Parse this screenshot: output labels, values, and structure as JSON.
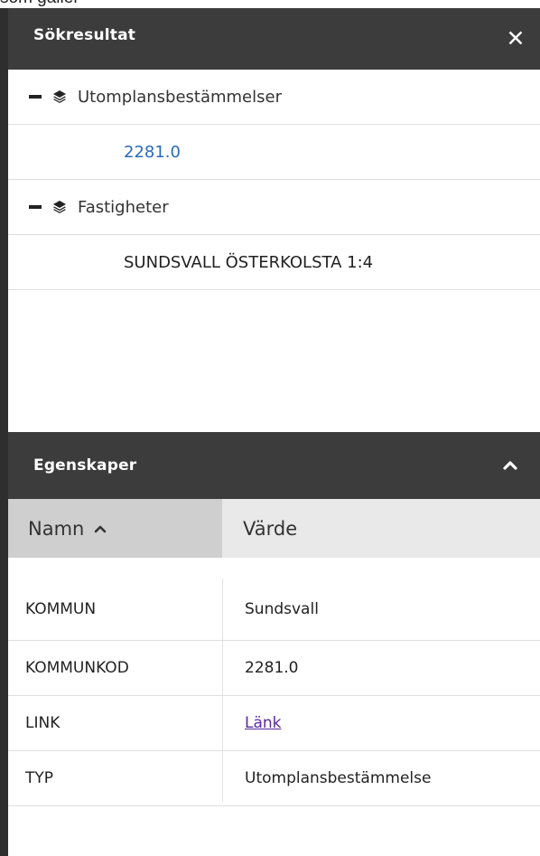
{
  "top_text": "som gäller",
  "search_panel": {
    "title": "Sökresultat",
    "close_icon": "close-icon",
    "groups": [
      {
        "label": "Utomplansbestämmelser",
        "items": [
          "2281.0"
        ]
      },
      {
        "label": "Fastigheter",
        "items": [
          "SUNDSVALL ÖSTERKOLSTA 1:4"
        ]
      }
    ]
  },
  "properties_panel": {
    "title": "Egenskaper",
    "collapse_icon": "chevron-up-icon",
    "columns": {
      "name": "Namn",
      "value": "Värde"
    },
    "rows": [
      {
        "key": "KOMMUN",
        "value": "Sundsvall"
      },
      {
        "key": "KOMMUNKOD",
        "value": "2281.0"
      },
      {
        "key": "LINK",
        "value": "Länk"
      },
      {
        "key": "TYP",
        "value": "Utomplansbestämmelse"
      }
    ]
  },
  "colors": {
    "header_bg": "#3c3c3c",
    "link_blue": "#2a6ab8",
    "link_visited": "#5a2aa0",
    "sorted_col_bg": "#cfcfcf",
    "table_head_bg": "#e9e9e9"
  }
}
